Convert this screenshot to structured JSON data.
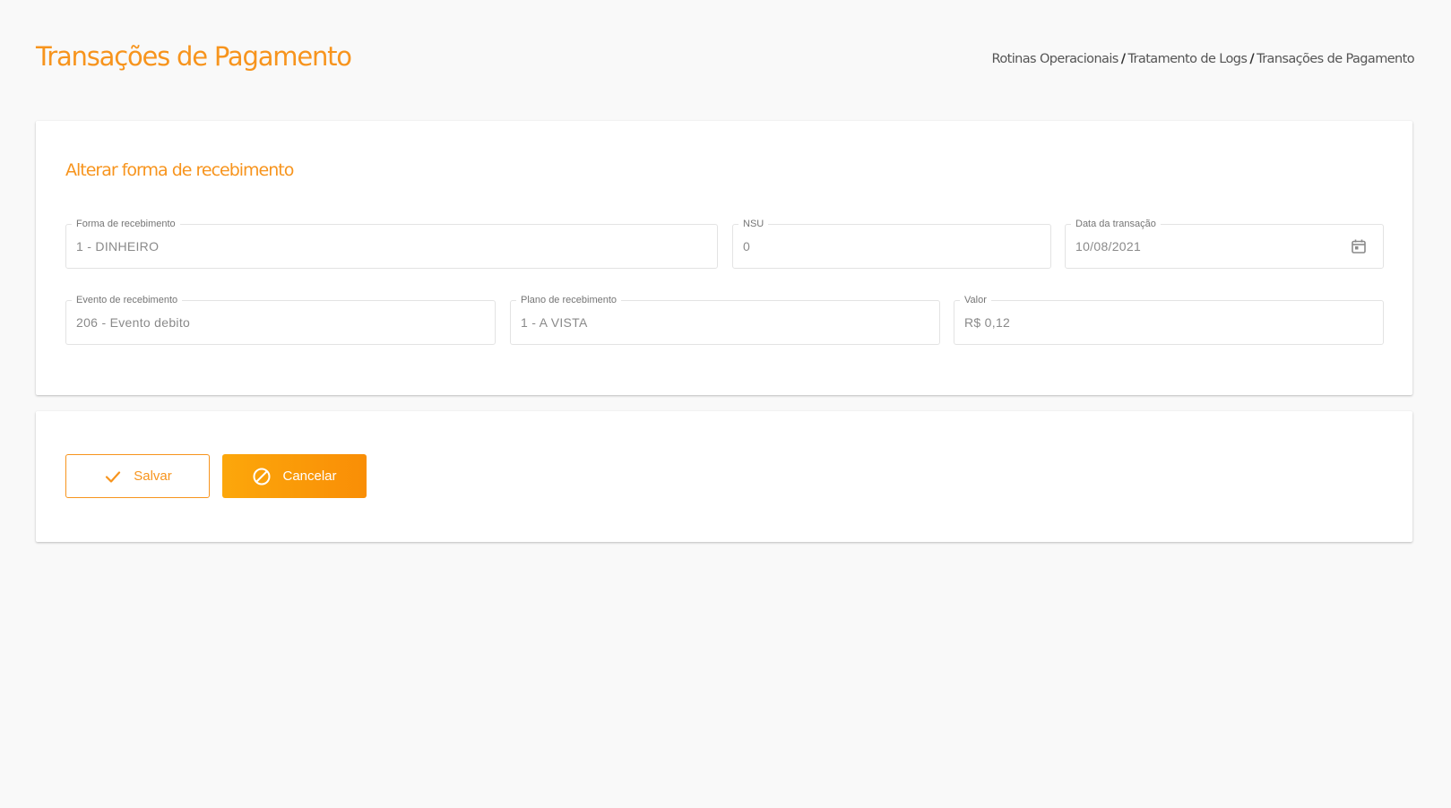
{
  "header": {
    "title": "Transações de Pagamento",
    "breadcrumb": [
      "Rotinas Operacionais",
      "Tratamento de Logs",
      "Transações de Pagamento"
    ],
    "breadcrumb_separator": "/"
  },
  "form": {
    "title": "Alterar forma de recebimento",
    "fields": {
      "forma_recebimento": {
        "label": "Forma de recebimento",
        "value": "1 - DINHEIRO"
      },
      "nsu": {
        "label": "NSU",
        "value": "0"
      },
      "data_transacao": {
        "label": "Data da transação",
        "value": "10/08/2021",
        "icon": "calendar-icon"
      },
      "evento_recebimento": {
        "label": "Evento de recebimento",
        "value": "206 - Evento debito"
      },
      "plano_recebimento": {
        "label": "Plano de recebimento",
        "value": "1 - A VISTA"
      },
      "valor": {
        "label": "Valor",
        "value": "R$ 0,12"
      }
    }
  },
  "actions": {
    "save_label": "Salvar",
    "save_icon": "check-icon",
    "cancel_label": "Cancelar",
    "cancel_icon": "ban-icon"
  },
  "colors": {
    "accent": "#f7941d",
    "cancel_gradient_start": "#fca70b",
    "cancel_gradient_end": "#f98e06",
    "background": "#f9f9f9"
  }
}
